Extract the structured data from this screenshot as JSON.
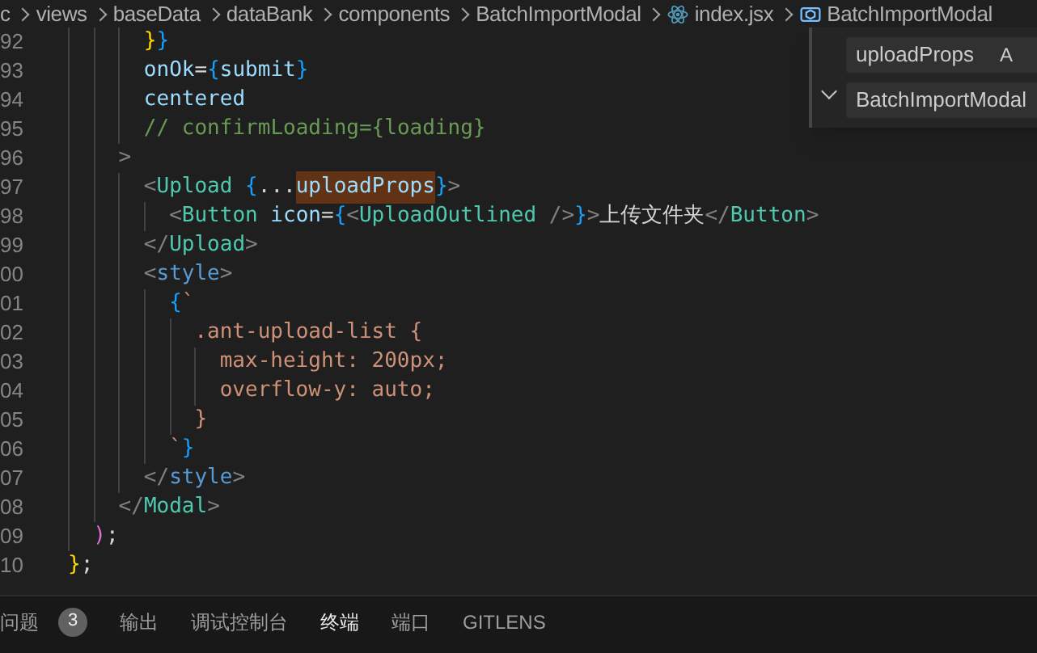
{
  "breadcrumb": [
    {
      "label": "c",
      "kind": "folder"
    },
    {
      "label": "views",
      "kind": "folder"
    },
    {
      "label": "baseData",
      "kind": "folder"
    },
    {
      "label": "dataBank",
      "kind": "folder"
    },
    {
      "label": "components",
      "kind": "folder"
    },
    {
      "label": "BatchImportModal",
      "kind": "folder"
    },
    {
      "label": "index.jsx",
      "kind": "file"
    },
    {
      "label": "BatchImportModal",
      "kind": "symbol"
    }
  ],
  "editor": {
    "lines": [
      {
        "number": "92",
        "tokens": [
          {
            "text": "      }",
            "kind": "brace-gold"
          },
          {
            "text": "}",
            "kind": "brace-blue"
          }
        ]
      },
      {
        "number": "93",
        "tokens": [
          {
            "text": "      onOk",
            "kind": "attr"
          },
          {
            "text": "=",
            "kind": "plain"
          },
          {
            "text": "{",
            "kind": "brace-blue"
          },
          {
            "text": "submit",
            "kind": "attr"
          },
          {
            "text": "}",
            "kind": "brace-blue"
          }
        ]
      },
      {
        "number": "94",
        "tokens": [
          {
            "text": "      centered",
            "kind": "attr"
          }
        ]
      },
      {
        "number": "95",
        "tokens": [
          {
            "text": "      // confirmLoading={loading}",
            "kind": "comment"
          }
        ]
      },
      {
        "number": "96",
        "tokens": [
          {
            "text": "    >",
            "kind": "punct"
          }
        ]
      },
      {
        "number": "97",
        "tokens": [
          {
            "text": "      <",
            "kind": "punct"
          },
          {
            "text": "Upload",
            "kind": "component"
          },
          {
            "text": " {",
            "kind": "brace-blue"
          },
          {
            "text": "...",
            "kind": "plain"
          },
          {
            "text": "uploadProps",
            "kind": "find-match"
          },
          {
            "text": "}",
            "kind": "brace-blue"
          },
          {
            "text": ">",
            "kind": "punct"
          }
        ]
      },
      {
        "number": "98",
        "tokens": [
          {
            "text": "        <",
            "kind": "punct"
          },
          {
            "text": "Button",
            "kind": "component"
          },
          {
            "text": " icon",
            "kind": "attr"
          },
          {
            "text": "=",
            "kind": "plain"
          },
          {
            "text": "{",
            "kind": "brace-blue"
          },
          {
            "text": "<",
            "kind": "punct"
          },
          {
            "text": "UploadOutlined",
            "kind": "component"
          },
          {
            "text": " />",
            "kind": "punct"
          },
          {
            "text": "}",
            "kind": "brace-blue"
          },
          {
            "text": ">",
            "kind": "punct"
          },
          {
            "text": "上传文件夹",
            "kind": "plain"
          },
          {
            "text": "</",
            "kind": "punct"
          },
          {
            "text": "Button",
            "kind": "component"
          },
          {
            "text": ">",
            "kind": "punct"
          }
        ]
      },
      {
        "number": "99",
        "tokens": [
          {
            "text": "      </",
            "kind": "punct"
          },
          {
            "text": "Upload",
            "kind": "component"
          },
          {
            "text": ">",
            "kind": "punct"
          }
        ]
      },
      {
        "number": "00",
        "tokens": [
          {
            "text": "      <",
            "kind": "punct"
          },
          {
            "text": "style",
            "kind": "tag"
          },
          {
            "text": ">",
            "kind": "punct"
          }
        ]
      },
      {
        "number": "01",
        "tokens": [
          {
            "text": "        {",
            "kind": "brace-blue"
          },
          {
            "text": "`",
            "kind": "string"
          }
        ]
      },
      {
        "number": "02",
        "tokens": [
          {
            "text": "          .ant-upload-list {",
            "kind": "string"
          }
        ]
      },
      {
        "number": "03",
        "tokens": [
          {
            "text": "            max-height: 200px;",
            "kind": "string"
          }
        ]
      },
      {
        "number": "04",
        "tokens": [
          {
            "text": "            overflow-y: auto;",
            "kind": "string"
          }
        ]
      },
      {
        "number": "05",
        "tokens": [
          {
            "text": "          }",
            "kind": "string"
          }
        ]
      },
      {
        "number": "06",
        "tokens": [
          {
            "text": "        `",
            "kind": "string"
          },
          {
            "text": "}",
            "kind": "brace-blue"
          }
        ]
      },
      {
        "number": "07",
        "tokens": [
          {
            "text": "      </",
            "kind": "punct"
          },
          {
            "text": "style",
            "kind": "tag"
          },
          {
            "text": ">",
            "kind": "punct"
          }
        ]
      },
      {
        "number": "08",
        "tokens": [
          {
            "text": "    </",
            "kind": "punct"
          },
          {
            "text": "Modal",
            "kind": "component"
          },
          {
            "text": ">",
            "kind": "punct"
          }
        ]
      },
      {
        "number": "09",
        "tokens": [
          {
            "text": "  )",
            "kind": "brace-pink"
          },
          {
            "text": ";",
            "kind": "plain"
          }
        ]
      },
      {
        "number": "10",
        "tokens": [
          {
            "text": "}",
            "kind": "brace-gold"
          },
          {
            "text": ";",
            "kind": "plain"
          }
        ]
      }
    ]
  },
  "find_widget": {
    "find": "uploadProps",
    "replace": "BatchImportModal",
    "match_case": "A"
  },
  "panel_tabs": [
    {
      "label": "问题",
      "selected": false,
      "badge": "3"
    },
    {
      "label": "输出",
      "selected": false
    },
    {
      "label": "调试控制台",
      "selected": false
    },
    {
      "label": "终端",
      "selected": true
    },
    {
      "label": "端口",
      "selected": false
    },
    {
      "label": "GITLENS",
      "selected": false
    }
  ]
}
